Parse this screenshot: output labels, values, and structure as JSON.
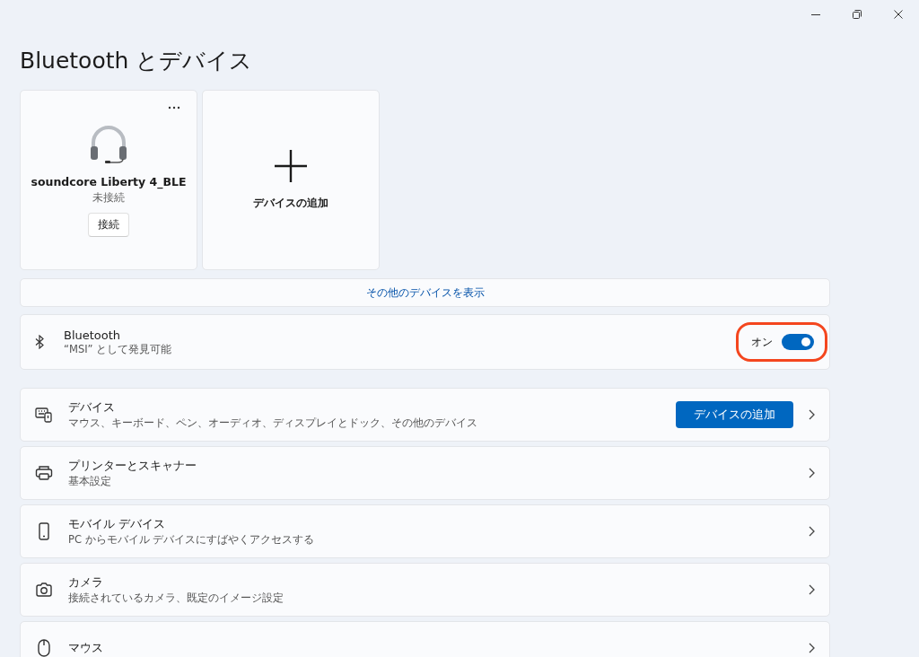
{
  "page_title": "Bluetooth とデバイス",
  "device_cards": [
    {
      "kind": "device",
      "name": "soundcore Liberty 4_BLE",
      "status": "未接続",
      "button": "接続"
    },
    {
      "kind": "add",
      "label": "デバイスの追加"
    }
  ],
  "show_more": "その他のデバイスを表示",
  "bluetooth": {
    "title": "Bluetooth",
    "subtitle": "“MSI” として発見可能",
    "state_label": "オン",
    "on": true,
    "highlighted": true
  },
  "rows": [
    {
      "title": "デバイス",
      "subtitle": "マウス、キーボード、ペン、オーディオ、ディスプレイとドック、その他のデバイス",
      "button": "デバイスの追加"
    },
    {
      "title": "プリンターとスキャナー",
      "subtitle": "基本設定"
    },
    {
      "title": "モバイル デバイス",
      "subtitle": "PC からモバイル デバイスにすばやくアクセスする"
    },
    {
      "title": "カメラ",
      "subtitle": "接続されているカメラ、既定のイメージ設定"
    },
    {
      "title": "マウス"
    }
  ]
}
